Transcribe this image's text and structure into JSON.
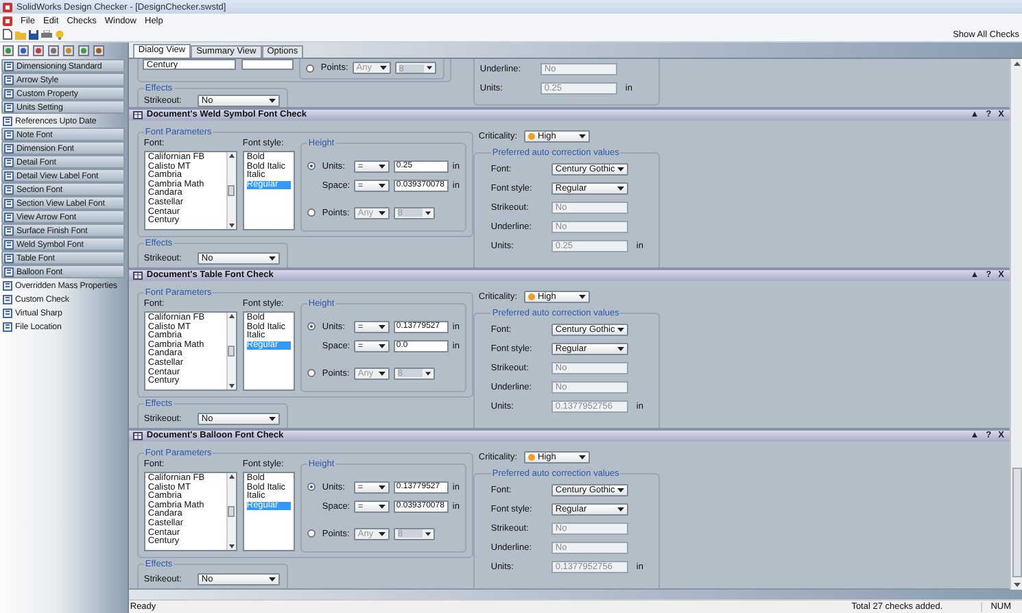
{
  "window": {
    "title": "SolidWorks Design Checker - [DesignChecker.swstd]"
  },
  "menu": [
    "File",
    "Edit",
    "Checks",
    "Window",
    "Help"
  ],
  "toolbar": {
    "show_all_button": "Show All Checks"
  },
  "sidebar": {
    "items": [
      {
        "label": "Dimensioning Standard",
        "raised": true
      },
      {
        "label": "Arrow Style",
        "raised": true
      },
      {
        "label": "Custom Property",
        "raised": true
      },
      {
        "label": "Units Setting",
        "raised": true
      },
      {
        "label": "References Upto Date",
        "raised": false
      },
      {
        "label": "Note Font",
        "raised": true
      },
      {
        "label": "Dimension Font",
        "raised": true
      },
      {
        "label": "Detail Font",
        "raised": true
      },
      {
        "label": "Detail View Label Font",
        "raised": true
      },
      {
        "label": "Section Font",
        "raised": true
      },
      {
        "label": "Section View Label Font",
        "raised": true
      },
      {
        "label": "View Arrow Font",
        "raised": true
      },
      {
        "label": "Surface Finish Font",
        "raised": true
      },
      {
        "label": "Weld Symbol Font",
        "raised": true
      },
      {
        "label": "Table Font",
        "raised": true
      },
      {
        "label": "Balloon Font",
        "raised": true
      },
      {
        "label": "Overridden Mass Properties",
        "raised": false
      },
      {
        "label": "Custom Check",
        "raised": false
      },
      {
        "label": "Virtual Sharp",
        "raised": false
      },
      {
        "label": "File Location",
        "raised": false
      }
    ]
  },
  "tabs": [
    {
      "label": "Dialog View",
      "selected": true
    },
    {
      "label": "Summary View",
      "selected": false
    },
    {
      "label": "Options",
      "selected": false
    }
  ],
  "partial_check": {
    "fonts": [
      "Century"
    ],
    "points": {
      "label": "Points:",
      "selected": false,
      "disabled": true,
      "operator": "Any",
      "value": "8"
    },
    "effects_legend": "Effects",
    "strikeout": {
      "label": "Strikeout:",
      "value": "No"
    },
    "corrections": [
      {
        "label": "Underline:",
        "value": "No",
        "kind": "readonly"
      },
      {
        "label": "Units:",
        "value": "0.25",
        "kind": "readonly",
        "unit": "in"
      }
    ]
  },
  "checks": [
    {
      "title": "Document's Weld Symbol Font Check",
      "header_controls": [
        "▲",
        "?",
        "X"
      ],
      "font_parameters_legend": "Font Parameters",
      "font_label": "Font:",
      "fonts": [
        "Californian FB",
        "Calisto MT",
        "Cambria",
        "Cambria Math",
        "Candara",
        "Castellar",
        "Centaur",
        "Century"
      ],
      "style_label": "Font style:",
      "styles": [
        {
          "label": "Bold",
          "selected": false
        },
        {
          "label": "Bold Italic",
          "selected": false
        },
        {
          "label": "Italic",
          "selected": false
        },
        {
          "label": "Regular",
          "selected": true
        }
      ],
      "height_legend": "Height",
      "units": {
        "label": "Units:",
        "selected": true,
        "operator": "=",
        "value": "0.25",
        "unit": "in"
      },
      "space": {
        "label": "Space:",
        "operator": "=",
        "value": "0.039370078",
        "unit": "in"
      },
      "points": {
        "label": "Points:",
        "selected": false,
        "disabled": true,
        "operator": "Any",
        "value": "8"
      },
      "effects_legend": "Effects",
      "strikeout": {
        "label": "Strikeout:",
        "value": "No"
      },
      "criticality": {
        "label": "Criticality:",
        "value": "High"
      },
      "correction_legend": "Preferred auto correction values",
      "corrections": [
        {
          "label": "Font:",
          "value": "Century Gothic",
          "kind": "dropdown"
        },
        {
          "label": "Font style:",
          "value": "Regular",
          "kind": "dropdown"
        },
        {
          "label": "Strikeout:",
          "value": "No",
          "kind": "readonly"
        },
        {
          "label": "Underline:",
          "value": "No",
          "kind": "readonly"
        },
        {
          "label": "Units:",
          "value": "0.25",
          "kind": "readonly",
          "unit": "in"
        }
      ]
    },
    {
      "title": "Document's Table Font Check",
      "header_controls": [
        "▲",
        "?",
        "X"
      ],
      "font_parameters_legend": "Font Parameters",
      "font_label": "Font:",
      "fonts": [
        "Californian FB",
        "Calisto MT",
        "Cambria",
        "Cambria Math",
        "Candara",
        "Castellar",
        "Centaur",
        "Century"
      ],
      "style_label": "Font style:",
      "styles": [
        {
          "label": "Bold",
          "selected": false
        },
        {
          "label": "Bold Italic",
          "selected": false
        },
        {
          "label": "Italic",
          "selected": false
        },
        {
          "label": "Regular",
          "selected": true
        }
      ],
      "height_legend": "Height",
      "units": {
        "label": "Units:",
        "selected": true,
        "operator": "=",
        "value": "0.13779527",
        "unit": "in"
      },
      "space": {
        "label": "Space:",
        "operator": "=",
        "value": "0.0",
        "unit": "in"
      },
      "points": {
        "label": "Points:",
        "selected": false,
        "disabled": true,
        "operator": "Any",
        "value": "8"
      },
      "effects_legend": "Effects",
      "strikeout": {
        "label": "Strikeout:",
        "value": "No"
      },
      "criticality": {
        "label": "Criticality:",
        "value": "High"
      },
      "correction_legend": "Preferred auto correction values",
      "corrections": [
        {
          "label": "Font:",
          "value": "Century Gothic",
          "kind": "dropdown"
        },
        {
          "label": "Font style:",
          "value": "Regular",
          "kind": "dropdown"
        },
        {
          "label": "Strikeout:",
          "value": "No",
          "kind": "readonly"
        },
        {
          "label": "Underline:",
          "value": "No",
          "kind": "readonly"
        },
        {
          "label": "Units:",
          "value": "0.1377952756",
          "kind": "readonly",
          "unit": "in"
        }
      ]
    },
    {
      "title": "Document's Balloon Font Check",
      "header_controls": [
        "▲",
        "?",
        "X"
      ],
      "font_parameters_legend": "Font Parameters",
      "font_label": "Font:",
      "fonts": [
        "Californian FB",
        "Calisto MT",
        "Cambria",
        "Cambria Math",
        "Candara",
        "Castellar",
        "Centaur",
        "Century"
      ],
      "style_label": "Font style:",
      "styles": [
        {
          "label": "Bold",
          "selected": false
        },
        {
          "label": "Bold Italic",
          "selected": false
        },
        {
          "label": "Italic",
          "selected": false
        },
        {
          "label": "Regular",
          "selected": true
        }
      ],
      "height_legend": "Height",
      "units": {
        "label": "Units:",
        "selected": true,
        "operator": "=",
        "value": "0.13779527",
        "unit": "in"
      },
      "space": {
        "label": "Space:",
        "operator": "=",
        "value": "0.039370078",
        "unit": "in"
      },
      "points": {
        "label": "Points:",
        "selected": false,
        "disabled": true,
        "operator": "Any",
        "value": "8"
      },
      "effects_legend": "Effects",
      "strikeout": {
        "label": "Strikeout:",
        "value": "No"
      },
      "criticality": {
        "label": "Criticality:",
        "value": "High"
      },
      "correction_legend": "Preferred auto correction values",
      "corrections": [
        {
          "label": "Font:",
          "value": "Century Gothic",
          "kind": "dropdown"
        },
        {
          "label": "Font style:",
          "value": "Regular",
          "kind": "dropdown"
        },
        {
          "label": "Strikeout:",
          "value": "No",
          "kind": "readonly"
        },
        {
          "label": "Underline:",
          "value": "No",
          "kind": "readonly"
        },
        {
          "label": "Units:",
          "value": "0.1377952756",
          "kind": "readonly",
          "unit": "in"
        }
      ]
    }
  ],
  "status_bar": {
    "message": "Ready",
    "summary": "Total 27 checks added.",
    "indicator": "NUM"
  }
}
